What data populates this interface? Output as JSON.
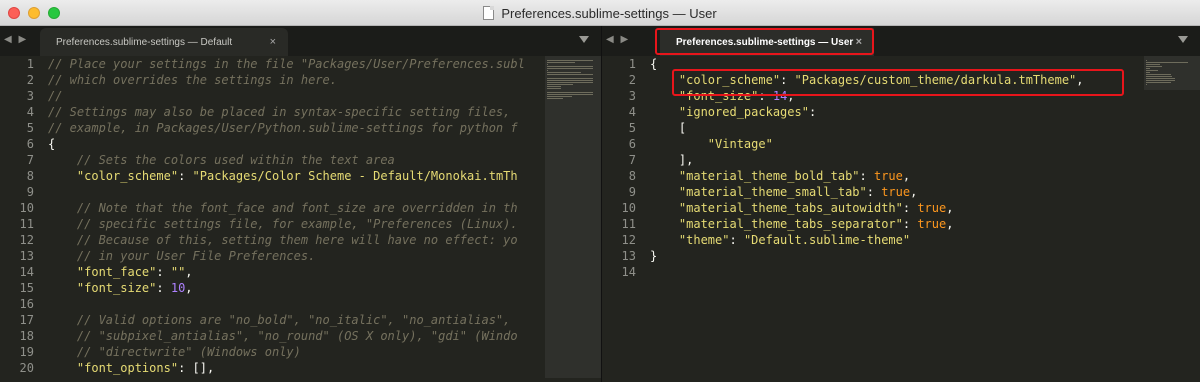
{
  "window": {
    "title": "Preferences.sublime-settings — User"
  },
  "left_pane": {
    "tab_label": "Preferences.sublime-settings — Default",
    "tab_close": "×",
    "nav": "◀ ▶",
    "line_numbers": [
      "1",
      "2",
      "3",
      "4",
      "5",
      "6",
      "7",
      "8",
      "9",
      "10",
      "11",
      "12",
      "13",
      "14",
      "15",
      "16",
      "17",
      "18",
      "19",
      "20"
    ]
  },
  "right_pane": {
    "tab_label": "Preferences.sublime-settings — User",
    "tab_close": "×",
    "nav": "◀ ▶",
    "line_numbers": [
      "1",
      "2",
      "3",
      "4",
      "5",
      "6",
      "7",
      "8",
      "9",
      "10",
      "11",
      "12",
      "13",
      "14"
    ]
  },
  "left_code": [
    [
      {
        "t": "// Place your settings in the file \"Packages/User/Preferences.subl",
        "c": "cmt"
      }
    ],
    [
      {
        "t": "// which overrides the settings in here.",
        "c": "cmt"
      }
    ],
    [
      {
        "t": "//",
        "c": "cmt"
      }
    ],
    [
      {
        "t": "// Settings may also be placed in syntax-specific setting files, ",
        "c": "cmt"
      }
    ],
    [
      {
        "t": "// example, in Packages/User/Python.sublime-settings for python f",
        "c": "cmt"
      }
    ],
    [
      {
        "t": "{",
        "c": ""
      }
    ],
    [
      {
        "t": "    // Sets the colors used within the text area",
        "c": "cmt"
      }
    ],
    [
      {
        "t": "    ",
        "c": ""
      },
      {
        "t": "\"color_scheme\"",
        "c": "key"
      },
      {
        "t": ": ",
        "c": ""
      },
      {
        "t": "\"Packages/Color Scheme - Default/Monokai.tmTh",
        "c": "str"
      }
    ],
    [
      {
        "t": "",
        "c": ""
      }
    ],
    [
      {
        "t": "    // Note that the font_face and font_size are overridden in th",
        "c": "cmt"
      }
    ],
    [
      {
        "t": "    // specific settings file, for example, \"Preferences (Linux).",
        "c": "cmt"
      }
    ],
    [
      {
        "t": "    // Because of this, setting them here will have no effect: yo",
        "c": "cmt"
      }
    ],
    [
      {
        "t": "    // in your User File Preferences.",
        "c": "cmt"
      }
    ],
    [
      {
        "t": "    ",
        "c": ""
      },
      {
        "t": "\"font_face\"",
        "c": "key"
      },
      {
        "t": ": ",
        "c": ""
      },
      {
        "t": "\"\"",
        "c": "str"
      },
      {
        "t": ",",
        "c": ""
      }
    ],
    [
      {
        "t": "    ",
        "c": ""
      },
      {
        "t": "\"font_size\"",
        "c": "key"
      },
      {
        "t": ": ",
        "c": ""
      },
      {
        "t": "10",
        "c": "num"
      },
      {
        "t": ",",
        "c": ""
      }
    ],
    [
      {
        "t": "",
        "c": ""
      }
    ],
    [
      {
        "t": "    // Valid options are \"no_bold\", \"no_italic\", \"no_antialias\", ",
        "c": "cmt"
      }
    ],
    [
      {
        "t": "    // \"subpixel_antialias\", \"no_round\" (OS X only), \"gdi\" (Windo",
        "c": "cmt"
      }
    ],
    [
      {
        "t": "    // \"directwrite\" (Windows only)",
        "c": "cmt"
      }
    ],
    [
      {
        "t": "    ",
        "c": ""
      },
      {
        "t": "\"font_options\"",
        "c": "key"
      },
      {
        "t": ": [],",
        "c": ""
      }
    ]
  ],
  "right_code": [
    [
      {
        "t": "{",
        "c": ""
      }
    ],
    [
      {
        "t": "    ",
        "c": ""
      },
      {
        "t": "\"color_scheme\"",
        "c": "key"
      },
      {
        "t": ": ",
        "c": ""
      },
      {
        "t": "\"Packages/custom_theme/darkula.tmTheme\"",
        "c": "str"
      },
      {
        "t": ",",
        "c": ""
      }
    ],
    [
      {
        "t": "    ",
        "c": ""
      },
      {
        "t": "\"font_size\"",
        "c": "key"
      },
      {
        "t": ": ",
        "c": ""
      },
      {
        "t": "14",
        "c": "num"
      },
      {
        "t": ",",
        "c": ""
      }
    ],
    [
      {
        "t": "    ",
        "c": ""
      },
      {
        "t": "\"ignored_packages\"",
        "c": "key"
      },
      {
        "t": ":",
        "c": ""
      }
    ],
    [
      {
        "t": "    [",
        "c": ""
      }
    ],
    [
      {
        "t": "        ",
        "c": ""
      },
      {
        "t": "\"Vintage\"",
        "c": "str"
      }
    ],
    [
      {
        "t": "    ],",
        "c": ""
      }
    ],
    [
      {
        "t": "    ",
        "c": ""
      },
      {
        "t": "\"material_theme_bold_tab\"",
        "c": "key"
      },
      {
        "t": ": ",
        "c": ""
      },
      {
        "t": "true",
        "c": "bool"
      },
      {
        "t": ",",
        "c": ""
      }
    ],
    [
      {
        "t": "    ",
        "c": ""
      },
      {
        "t": "\"material_theme_small_tab\"",
        "c": "key"
      },
      {
        "t": ": ",
        "c": ""
      },
      {
        "t": "true",
        "c": "bool"
      },
      {
        "t": ",",
        "c": ""
      }
    ],
    [
      {
        "t": "    ",
        "c": ""
      },
      {
        "t": "\"material_theme_tabs_autowidth\"",
        "c": "key"
      },
      {
        "t": ": ",
        "c": ""
      },
      {
        "t": "true",
        "c": "bool"
      },
      {
        "t": ",",
        "c": ""
      }
    ],
    [
      {
        "t": "    ",
        "c": ""
      },
      {
        "t": "\"material_theme_tabs_separator\"",
        "c": "key"
      },
      {
        "t": ": ",
        "c": ""
      },
      {
        "t": "true",
        "c": "bool"
      },
      {
        "t": ",",
        "c": ""
      }
    ],
    [
      {
        "t": "    ",
        "c": ""
      },
      {
        "t": "\"theme\"",
        "c": "key"
      },
      {
        "t": ": ",
        "c": ""
      },
      {
        "t": "\"Default.sublime-theme\"",
        "c": "str"
      }
    ],
    [
      {
        "t": "}",
        "c": ""
      }
    ],
    [
      {
        "t": "",
        "c": ""
      }
    ]
  ],
  "colors": {
    "highlight": "#e8151b",
    "comment": "#75715e",
    "string": "#e6db74",
    "number": "#ae81ff",
    "boolean": "#fd971f",
    "background": "#23241f"
  }
}
